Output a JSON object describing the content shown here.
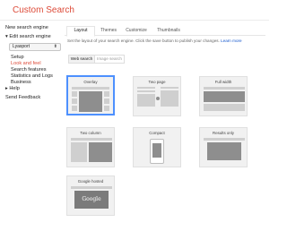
{
  "header": {
    "title": "Custom Search"
  },
  "sidebar": {
    "new_engine": "New search engine",
    "edit_engine": "Edit search engine",
    "selected_engine": "Lyasport",
    "setup": "Setup",
    "look_and_feel": "Look and feel",
    "search_features": "Search features",
    "statistics": "Statistics and Logs",
    "business": "Business",
    "help": "Help",
    "feedback": "Send Feedback"
  },
  "tabs": [
    "Layout",
    "Themes",
    "Customize",
    "Thumbnails"
  ],
  "description": {
    "text": "Set the layout of your search engine. Click the save button to publish your changes.",
    "link": "Learn more"
  },
  "subtabs": [
    "Web search",
    "Image search"
  ],
  "layouts": [
    {
      "label": "Overlay",
      "selected": true
    },
    {
      "label": "Two page",
      "selected": false
    },
    {
      "label": "Full width",
      "selected": false
    },
    {
      "label": "Two column",
      "selected": false
    },
    {
      "label": "Compact",
      "selected": false
    },
    {
      "label": "Results only",
      "selected": false
    },
    {
      "label": "Google hosted",
      "selected": false
    }
  ],
  "google_hosted_logo": "Google"
}
